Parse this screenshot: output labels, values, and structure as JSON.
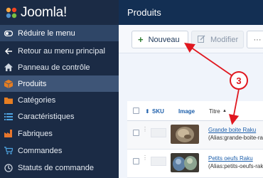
{
  "app": {
    "logo_text": "Joomla!"
  },
  "header": {
    "title": "Produits"
  },
  "sidebar": {
    "items": [
      {
        "label": "Réduire le menu",
        "icon": "toggle-icon"
      },
      {
        "label": "Retour au menu principal",
        "icon": "arrow-left-icon"
      },
      {
        "label": "Panneau de contrôle",
        "icon": "home-icon"
      },
      {
        "label": "Produits",
        "icon": "box-icon"
      },
      {
        "label": "Catégories",
        "icon": "folder-icon"
      },
      {
        "label": "Caractéristiques",
        "icon": "list-icon"
      },
      {
        "label": "Fabriques",
        "icon": "factory-icon"
      },
      {
        "label": "Commandes",
        "icon": "cart-icon"
      },
      {
        "label": "Statuts de commande",
        "icon": "status-icon"
      }
    ]
  },
  "toolbar": {
    "new_label": "Nouveau",
    "edit_label": "Modifier",
    "more_label": "···"
  },
  "table": {
    "headers": {
      "sku": "SKU",
      "image": "Image",
      "title": "Titre",
      "sort_indicator": "▲",
      "sku_sort": "⬍"
    },
    "rows": [
      {
        "name": "Grande boite Raku",
        "alias": "(Alias:grande-boite-rak"
      },
      {
        "name": "Petits oeufs Raku",
        "alias": "(Alias:petits-oeufs-rak"
      }
    ]
  },
  "annotation": {
    "number": "3",
    "color": "#e0171f"
  },
  "colors": {
    "sidebar": "#1b2b45",
    "header": "#132f53",
    "link": "#1d5fab",
    "new_icon": "#2f7d32"
  }
}
